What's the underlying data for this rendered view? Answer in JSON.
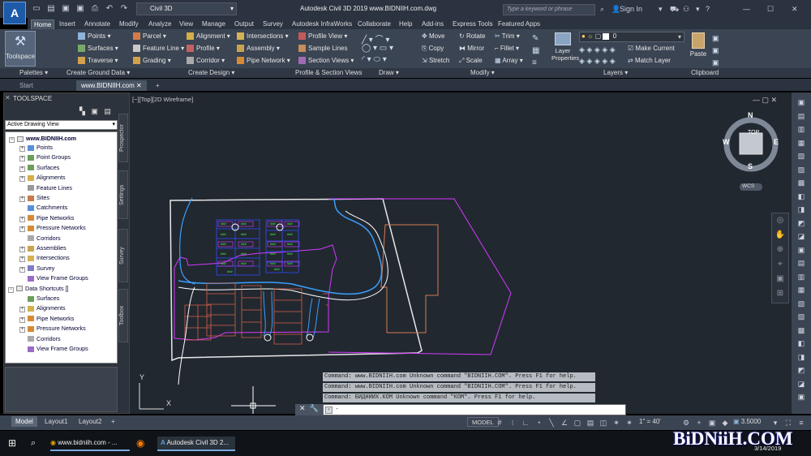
{
  "app": {
    "icon_letter": "A",
    "sub": "CIVIL"
  },
  "workspace": "Civil 3D",
  "window_title": "Autodesk Civil 3D 2019     www.BIDNIIH.com.dwg",
  "search_placeholder": "Type a keyword or phrase",
  "sign_in": "Sign In",
  "menu_tabs": [
    "Home",
    "Insert",
    "Annotate",
    "Modify",
    "Analyze",
    "View",
    "Manage",
    "Output",
    "Survey",
    "Autodesk InfraWorks",
    "Collaborate",
    "Help",
    "Add-ins",
    "Express Tools",
    "Featured Apps"
  ],
  "ribbon": {
    "toolspace": "Toolspace",
    "create_ground": [
      "Points",
      "Surfaces",
      "Traverse"
    ],
    "create_design_1": [
      "Parcel",
      "Feature Line",
      "Grading"
    ],
    "create_design_2": [
      "Alignment",
      "Profile",
      "Corridor"
    ],
    "create_design_3": [
      "Intersections",
      "Assembly",
      "Pipe Network"
    ],
    "profile_section": [
      "Profile View",
      "Sample Lines",
      "Section Views"
    ],
    "modify": [
      "Move",
      "Copy",
      "Stretch",
      "Rotate",
      "Mirror",
      "Scale",
      "Trim",
      "Fillet",
      "Array"
    ],
    "layer_properties": "Layer Properties",
    "layer_value": "0",
    "make_current": "Make Current",
    "match_layer": "Match Layer",
    "paste": "Paste"
  },
  "panels": [
    "Palettes",
    "Create Ground Data",
    "Create Design",
    "Profile & Section Views",
    "Draw",
    "Modify",
    "Layers",
    "Clipboard"
  ],
  "doc_tabs": [
    "Start",
    "www.BIDNIIH.com"
  ],
  "toolspace": {
    "title": "TOOLSPACE",
    "view": "Active Drawing View",
    "root": "www.BIDNIIH.com",
    "items": [
      "Points",
      "Point Groups",
      "Surfaces",
      "Alignments",
      "Feature Lines",
      "Sites",
      "Catchments",
      "Pipe Networks",
      "Pressure Networks",
      "Corridors",
      "Assemblies",
      "Intersections",
      "Survey",
      "View Frame Groups"
    ],
    "shortcuts": "Data Shortcuts []",
    "shortcut_items": [
      "Surfaces",
      "Alignments",
      "Pipe Networks",
      "Pressure Networks",
      "Corridors",
      "View Frame Groups"
    ],
    "side_tabs": [
      "Prospector",
      "Settings",
      "Survey",
      "Toolbox"
    ]
  },
  "viewport": {
    "label": "[−][Top][2D Wireframe]",
    "compass": {
      "n": "N",
      "s": "S",
      "e": "E",
      "w": "W",
      "top": "TOP",
      "wcs": "WCS"
    },
    "ucs_x": "X",
    "ucs_y": "Y"
  },
  "commands": [
    "Command: www.BIDNIIH.com Unknown command \"BIDNIIH.COM\".  Press F1 for help.",
    "Command: www.BIDNIIH.com Unknown command \"BIDNIIH.COM\".  Press F1 for help.",
    "Command: БИДНИИХ.КОМ Unknown command \"КОМ\".  Press F1 for help."
  ],
  "cmd_prompt": "-",
  "layouts": [
    "Model",
    "Layout1",
    "Layout2"
  ],
  "status": {
    "model": "MODEL",
    "scale": "1\" = 40'",
    "value": "3.5000"
  },
  "taskbar": {
    "chrome": "www.bidniih.com - ...",
    "civil": "Autodesk Civil 3D 2...",
    "date": "3/14/2019"
  },
  "watermark": "BiDNiiH.COM"
}
